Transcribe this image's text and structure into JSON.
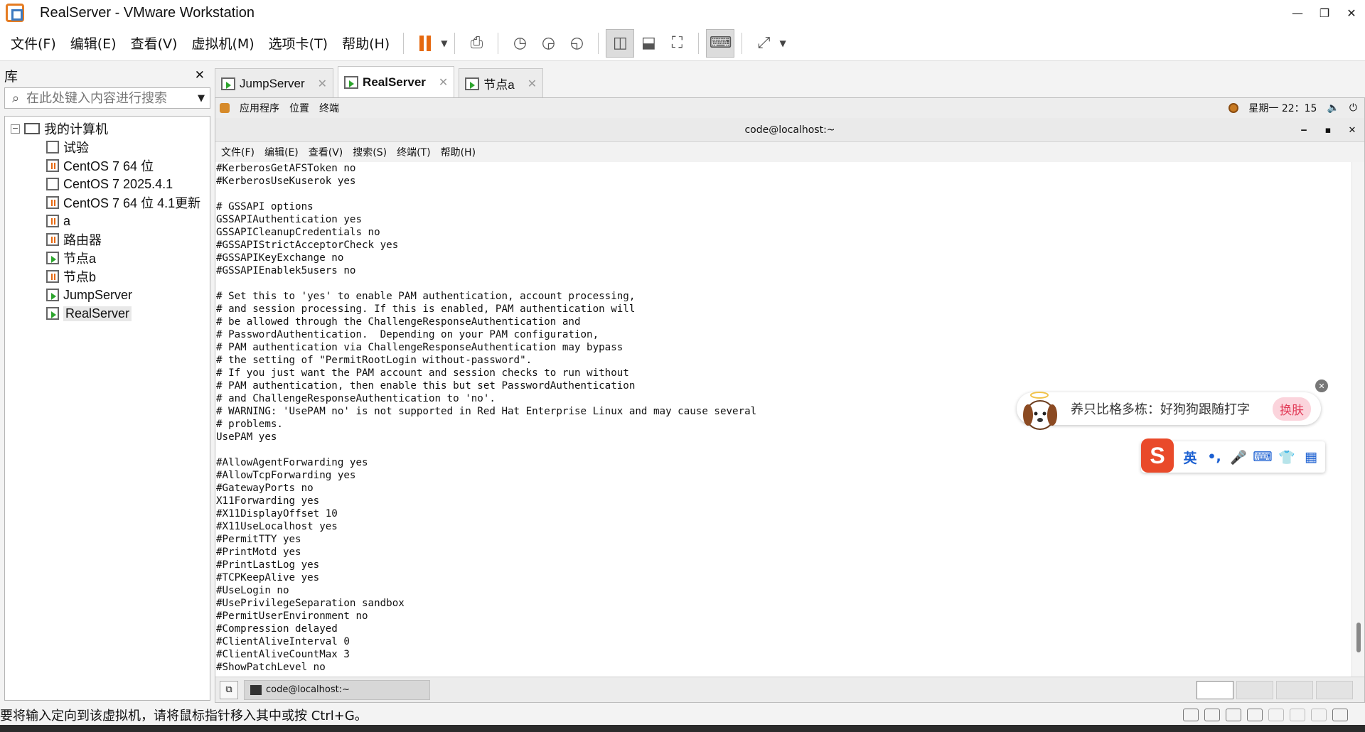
{
  "window": {
    "title": "RealServer - VMware Workstation",
    "controls": {
      "minimize": "—",
      "maximize": "❐",
      "close": "✕"
    }
  },
  "menu": [
    "文件(F)",
    "编辑(E)",
    "查看(V)",
    "虚拟机(M)",
    "选项卡(T)",
    "帮助(H)"
  ],
  "toolbar_icons": [
    "pause-icon",
    "send-keys-icon",
    "snapshot-icon",
    "revert-snapshot-icon",
    "snapshot-manager-icon",
    "library-view-icon",
    "thumbnail-view-icon",
    "fullscreen-icon",
    "console-icon",
    "stretch-icon"
  ],
  "library": {
    "title": "库",
    "close": "✕",
    "search_placeholder": "在此处键入内容进行搜索",
    "root": "我的计算机",
    "items": [
      {
        "label": "试验",
        "state": "off"
      },
      {
        "label": "CentOS 7 64 位",
        "state": "paused"
      },
      {
        "label": "CentOS 7 2025.4.1",
        "state": "off"
      },
      {
        "label": "CentOS 7 64 位 4.1更新",
        "state": "paused"
      },
      {
        "label": "a",
        "state": "paused"
      },
      {
        "label": "路由器",
        "state": "paused"
      },
      {
        "label": "节点a",
        "state": "on"
      },
      {
        "label": "节点b",
        "state": "paused"
      },
      {
        "label": "JumpServer",
        "state": "on"
      },
      {
        "label": "RealServer",
        "state": "on",
        "selected": true
      }
    ]
  },
  "tabs": [
    {
      "label": "JumpServer",
      "active": false,
      "close": "✕"
    },
    {
      "label": "RealServer",
      "active": true,
      "close": "✕"
    },
    {
      "label": "节点a",
      "active": false,
      "close": "✕"
    }
  ],
  "guest": {
    "panel": {
      "apps": "应用程序",
      "places": "位置",
      "terminal": "终端",
      "clock": "星期一 22：15"
    },
    "terminal": {
      "title": "code@localhost:~",
      "controls": {
        "minimize": "‒",
        "maximize": "▪",
        "close": "✕"
      },
      "menu": [
        "文件(F)",
        "编辑(E)",
        "查看(V)",
        "搜索(S)",
        "终端(T)",
        "帮助(H)"
      ],
      "lines": [
        "#KerberosGetAFSToken no",
        "#KerberosUseKuserok yes",
        "",
        "# GSSAPI options",
        "GSSAPIAuthentication yes",
        "GSSAPICleanupCredentials no",
        "#GSSAPIStrictAcceptorCheck yes",
        "#GSSAPIKeyExchange no",
        "#GSSAPIEnablek5users no",
        "",
        "# Set this to 'yes' to enable PAM authentication, account processing,",
        "# and session processing. If this is enabled, PAM authentication will",
        "# be allowed through the ChallengeResponseAuthentication and",
        "# PasswordAuthentication.  Depending on your PAM configuration,",
        "# PAM authentication via ChallengeResponseAuthentication may bypass",
        "# the setting of \"PermitRootLogin without-password\".",
        "# If you just want the PAM account and session checks to run without",
        "# PAM authentication, then enable this but set PasswordAuthentication",
        "# and ChallengeResponseAuthentication to 'no'.",
        "# WARNING: 'UsePAM no' is not supported in Red Hat Enterprise Linux and may cause several",
        "# problems.",
        "UsePAM yes",
        "",
        "#AllowAgentForwarding yes",
        "#AllowTcpForwarding yes",
        "#GatewayPorts no",
        "X11Forwarding yes",
        "#X11DisplayOffset 10",
        "#X11UseLocalhost yes",
        "#PermitTTY yes",
        "#PrintMotd yes",
        "#PrintLastLog yes",
        "#TCPKeepAlive yes",
        "#UseLogin no",
        "#UsePrivilegeSeparation sandbox",
        "#PermitUserEnvironment no",
        "#Compression delayed",
        "#ClientAliveInterval 0",
        "#ClientAliveCountMax 3",
        "#ShowPatchLevel no"
      ]
    },
    "taskbar": {
      "task": "code@localhost:~"
    }
  },
  "ime": {
    "tip": "养只比格多栋：好狗狗跟随打字",
    "skin": "换肤",
    "lang": "英",
    "punct": "•,",
    "close": "✕"
  },
  "statusbar": {
    "message": "要将输入定向到该虚拟机，请将鼠标指针移入其中或按 Ctrl+G。"
  },
  "colors": {
    "accent": "#e5680f",
    "running": "#2ea52e",
    "sogou": "#e94a2a",
    "ime_blue": "#1b5fd1"
  }
}
